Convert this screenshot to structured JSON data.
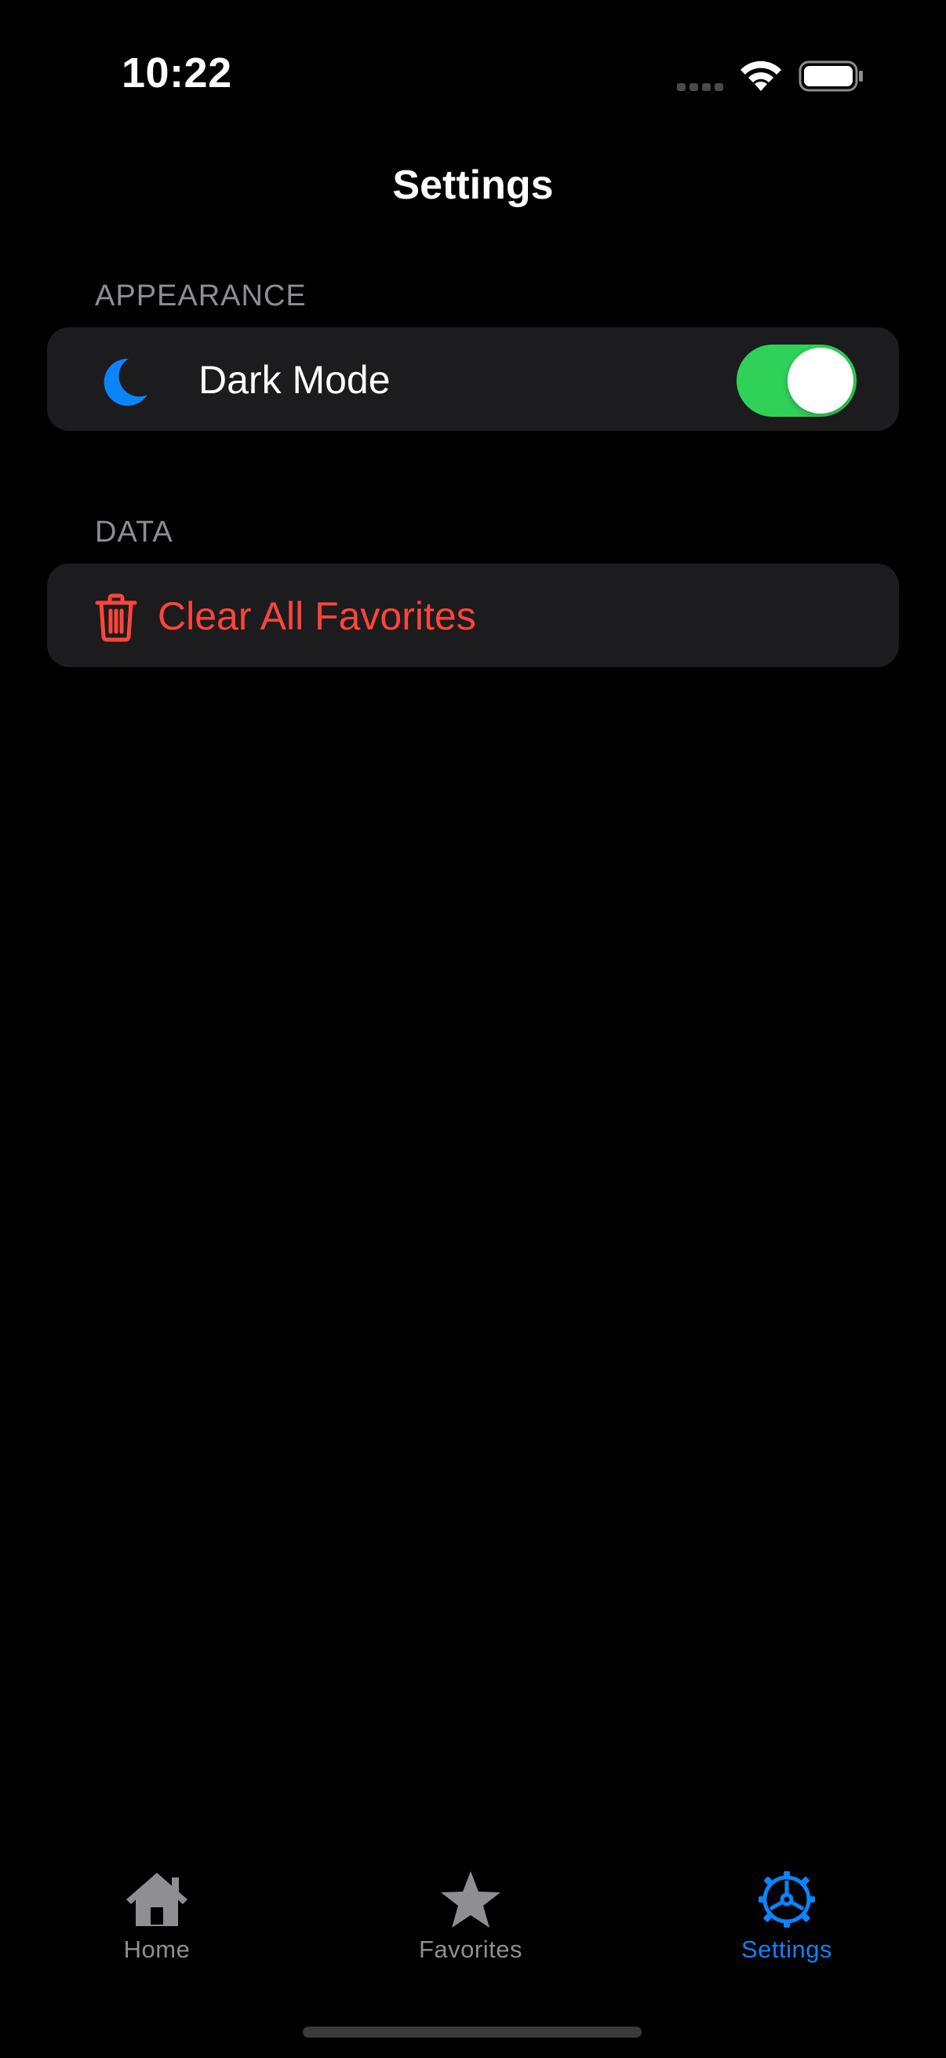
{
  "status_bar": {
    "time": "10:22",
    "icons": [
      "signal-dots-icon",
      "wifi-icon",
      "battery-icon"
    ]
  },
  "nav": {
    "title": "Settings"
  },
  "sections": [
    {
      "header": "APPEARANCE",
      "rows": [
        {
          "icon": "moon-icon",
          "label": "Dark Mode",
          "control": "toggle",
          "toggle_on": true
        }
      ]
    },
    {
      "header": "DATA",
      "rows": [
        {
          "icon": "trash-icon",
          "label": "Clear All Favorites",
          "control": "destructive-button"
        }
      ]
    }
  ],
  "tab_bar": {
    "tabs": [
      {
        "label": "Home",
        "icon": "house-icon",
        "selected": false
      },
      {
        "label": "Favorites",
        "icon": "star-icon",
        "selected": false
      },
      {
        "label": "Settings",
        "icon": "gear-icon",
        "selected": true
      }
    ]
  },
  "colors": {
    "background": "#000000",
    "card": "#1c1c1e",
    "accent": "#0a84ff",
    "toggle_on": "#30d158",
    "destructive": "#ff453a",
    "secondary_text": "#8d8d93"
  }
}
